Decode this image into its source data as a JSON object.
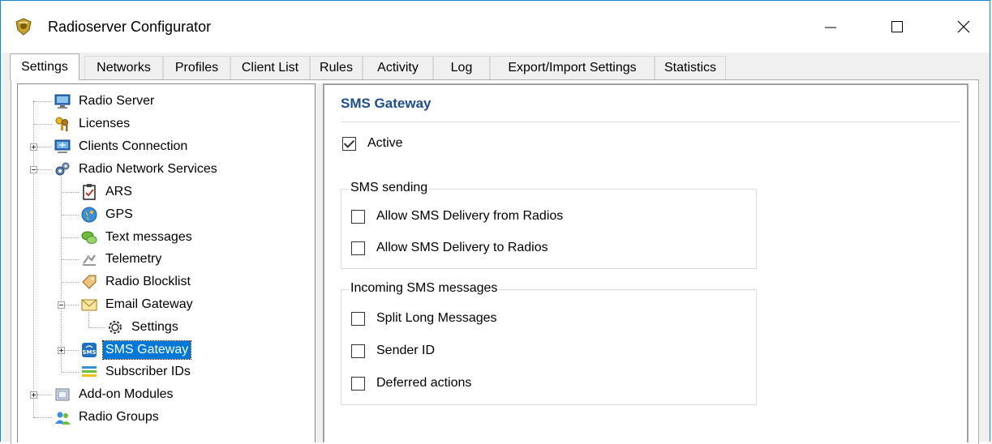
{
  "window": {
    "title": "Radioserver Configurator"
  },
  "tabs": [
    {
      "label": "Settings",
      "active": true
    },
    {
      "label": "Networks"
    },
    {
      "label": "Profiles"
    },
    {
      "label": "Client List"
    },
    {
      "label": "Rules"
    },
    {
      "label": "Activity"
    },
    {
      "label": "Log"
    },
    {
      "label": "Export/Import Settings"
    },
    {
      "label": "Statistics"
    }
  ],
  "tree": {
    "radio_server": "Radio Server",
    "licenses": "Licenses",
    "clients_connection": "Clients Connection",
    "radio_network_services": "Radio Network Services",
    "ars": "ARS",
    "gps": "GPS",
    "text_messages": "Text messages",
    "telemetry": "Telemetry",
    "radio_blocklist": "Radio Blocklist",
    "email_gateway": "Email Gateway",
    "email_settings": "Settings",
    "sms_gateway": "SMS Gateway",
    "subscriber_ids": "Subscriber IDs",
    "addon_modules": "Add-on Modules",
    "radio_groups": "Radio Groups"
  },
  "panel": {
    "title": "SMS Gateway",
    "active_label": "Active",
    "active_checked": true,
    "sms_sending": {
      "legend": "SMS sending",
      "allow_from_radios": "Allow SMS Delivery from Radios",
      "allow_to_radios": "Allow SMS Delivery to Radios"
    },
    "incoming": {
      "legend": "Incoming SMS messages",
      "split_long": "Split Long Messages",
      "sender_id": "Sender ID",
      "deferred": "Deferred actions"
    }
  },
  "colors": {
    "accent": "#0078d7",
    "title_blue": "#1e4e8c",
    "window_border": "#1883d7"
  }
}
